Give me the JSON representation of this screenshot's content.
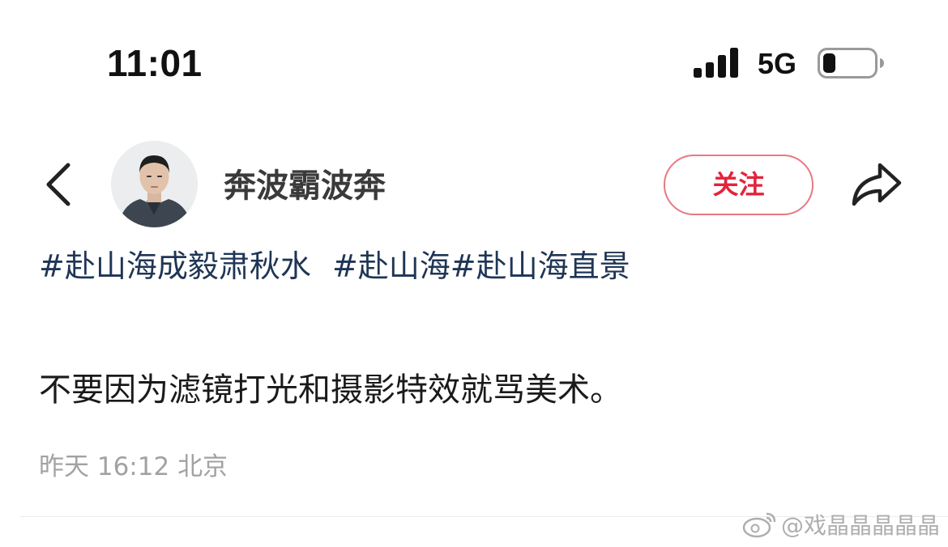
{
  "status_bar": {
    "time": "11:01",
    "network": "5G",
    "signal_bars": 4,
    "battery_level": 0.25
  },
  "header": {
    "username": "奔波霸波奔",
    "follow_label": "关注",
    "accent_color": "#e4233b"
  },
  "post": {
    "hashtags": [
      "#赴山海成毅肃秋水",
      "#赴山海",
      "#赴山海直景"
    ],
    "text": "不要因为滤镜打光和摄影特效就骂美术。",
    "time": "昨天 16:12",
    "location": "北京"
  },
  "watermark": {
    "text": "@戏晶晶晶晶晶"
  },
  "icons": {
    "back": "chevron-left-icon",
    "share": "share-arrow-icon",
    "signal": "cellular-signal-icon",
    "battery": "battery-icon",
    "weibo": "weibo-logo-icon"
  }
}
